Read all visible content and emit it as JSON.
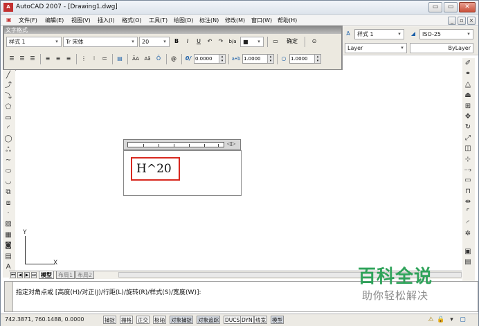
{
  "window": {
    "title": "AutoCAD 2007 - [Drawing1.dwg]",
    "min": "▭",
    "max": "▭",
    "close": "✕"
  },
  "menu": [
    "文件(F)",
    "编辑(E)",
    "视图(V)",
    "插入(I)",
    "格式(O)",
    "工具(T)",
    "绘图(D)",
    "标注(N)",
    "修改(M)",
    "窗口(W)",
    "帮助(H)"
  ],
  "doc_controls": {
    "min": "_",
    "restore": "▫",
    "close": "×"
  },
  "styles_toolbar": {
    "text_style": "样式 1",
    "dim_style": "ISO-25",
    "layer_style": "Layer",
    "bylayer": "ByLayer"
  },
  "text_formatting": {
    "title": "文字格式",
    "style": "样式 1",
    "font": "宋体",
    "font_icon": "Tr",
    "height": "20",
    "bold": "B",
    "italic": "I",
    "underline": "U",
    "undo": "↶",
    "redo": "↷",
    "stack": "b/a",
    "color": "■",
    "ruler_icon": "▭",
    "ok": "确定",
    "options": "⊙",
    "oblique_label": "0/",
    "oblique": "0.0000",
    "tracking_label": "a•b",
    "tracking": "1.0000",
    "width_label": "○",
    "width": "1.0000",
    "at_symbol": "@",
    "omega": "Ō",
    "case_upper": "ĀA",
    "case_lower": "Aā"
  },
  "mtext": {
    "content": "H^20",
    "end_marker": "◁▷"
  },
  "ucs": {
    "x": "X",
    "y": "Y"
  },
  "tabs": {
    "model": "模型",
    "layout1": "布局1",
    "layout2": "布局2"
  },
  "command_prompt": "指定对角点或 [高度(H)/对正(J)/行距(L)/旋转(R)/样式(S)/宽度(W)]:",
  "status": {
    "coords": "742.3871, 760.1488, 0.0000",
    "toggles": [
      {
        "label": "捕捉",
        "on": false
      },
      {
        "label": "栅格",
        "on": false
      },
      {
        "label": "正交",
        "on": false
      },
      {
        "label": "极轴",
        "on": false
      },
      {
        "label": "对象捕捉",
        "on": true
      },
      {
        "label": "对象追踪",
        "on": true
      },
      {
        "label": "DUCS",
        "on": false
      },
      {
        "label": "DYN",
        "on": false
      },
      {
        "label": "线宽",
        "on": false
      },
      {
        "label": "模型",
        "on": true
      }
    ]
  },
  "watermark": {
    "title": "百科全说",
    "subtitle": "助你轻松解决"
  },
  "colors": {
    "accent_red": "#d8281f",
    "watermark_green": "#2fa35a"
  }
}
